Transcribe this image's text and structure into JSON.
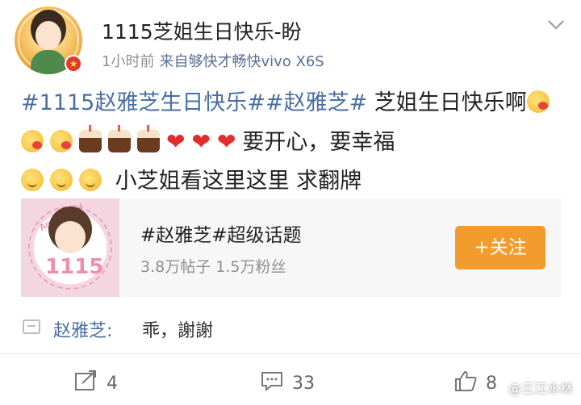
{
  "header": {
    "username": "1115芝姐生日快乐-盼",
    "time": "1小时前",
    "source": "来自够快才畅快vivo X6S",
    "vip_badge": "★"
  },
  "post": {
    "topic1": "#1115赵雅芝生日快乐#",
    "topic2": "#赵雅芝#",
    "text_part1": " 芝姐生日快乐啊",
    "text_part2": "要开心，要幸福",
    "text_part3": "小芝姐看这里这里 求翻牌",
    "heart": "❤"
  },
  "topic_card": {
    "title": "#赵雅芝#超级话题",
    "stats": "3.8万帖子 1.5万粉丝",
    "follow_label": "+关注",
    "image_number": "1115",
    "image_label": "Angie Chiu"
  },
  "comment": {
    "author": "赵雅芝:",
    "text": "乖，謝謝"
  },
  "actions": {
    "repost_count": "4",
    "comment_count": "33",
    "like_count": "8"
  },
  "watermark": "@三江水林",
  "icons": {
    "chevron": "chevron-down-icon",
    "repost": "repost-icon",
    "comment": "comment-icon",
    "like": "thumbs-up-icon"
  },
  "colors": {
    "link": "#4a6fa5",
    "follow": "#f39c2e",
    "meta": "#8f8f8f"
  }
}
